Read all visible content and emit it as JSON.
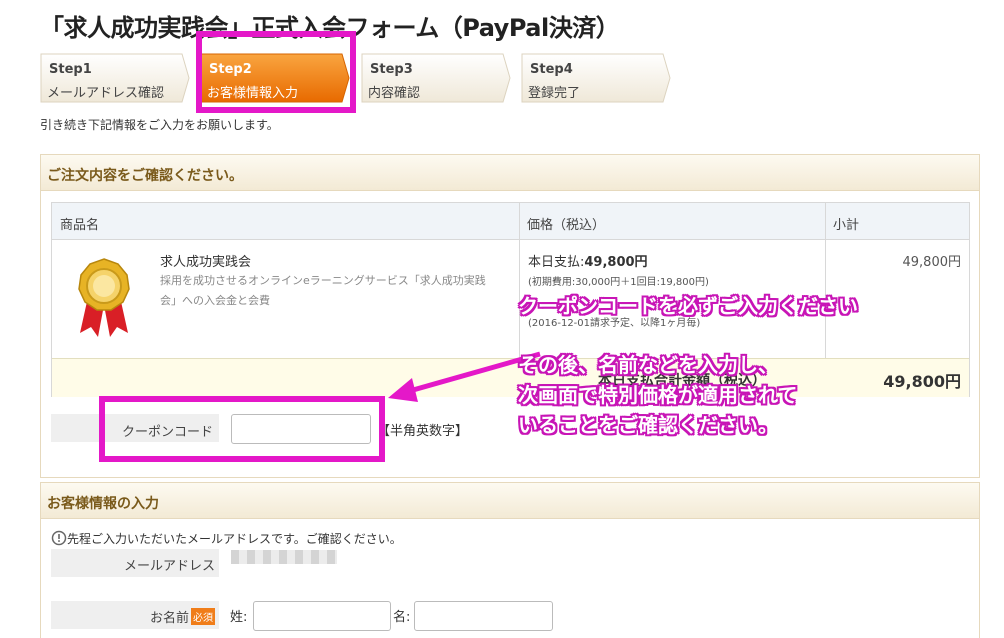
{
  "page": {
    "title": "「求人成功実践会」正式入会フォーム（PayPal決済）"
  },
  "steps": [
    {
      "num": "Step1",
      "label": "メールアドレス確認",
      "active": false
    },
    {
      "num": "Step2",
      "label": "お客様情報入力",
      "active": true
    },
    {
      "num": "Step3",
      "label": "内容確認",
      "active": false
    },
    {
      "num": "Step4",
      "label": "登録完了",
      "active": false
    }
  ],
  "lead_text": "引き続き下記情報をご入力をお願いします。",
  "order": {
    "section_title": "ご注文内容をご確認ください。",
    "columns": [
      "商品名",
      "価格（税込）",
      "小計"
    ],
    "product": {
      "name": "求人成功実践会",
      "desc_line1": "採用を成功させるオンラインeラーニングサービス「求人成功実践",
      "desc_line2": "会」への入会金と会費",
      "icon": "gold-medal-icon"
    },
    "price": {
      "today_label": "本日支払:",
      "today_value": "49,800円",
      "breakdown": "(初期費用:30,000円＋1回目:19,800円)",
      "recurring": "(2016-12-01請求予定、以降1ヶ月毎)"
    },
    "subtotal": "49,800円",
    "total_label": "本日支払合計金額（税込）",
    "total_value": "49,800円"
  },
  "coupon": {
    "label": "クーポンコード",
    "value": "",
    "note": "【半角英数字】"
  },
  "customer": {
    "section_title": "お客様情報の入力",
    "info_text": "先程ご入力いただいたメールアドレスです。ご確認ください。",
    "email_label": "メールアドレス",
    "name_label": "お名前",
    "required_badge": "必須",
    "last_name_label": "姓:",
    "first_name_label": "名:",
    "last_name_value": "",
    "first_name_value": ""
  },
  "annotations": {
    "line1": "クーポンコードを必ずご入力ください",
    "line2": "その後、名前などを入力し、",
    "line3": "次画面で特別価格が適用されて",
    "line4": "いることをご確認ください。",
    "color": "#e418c8"
  }
}
